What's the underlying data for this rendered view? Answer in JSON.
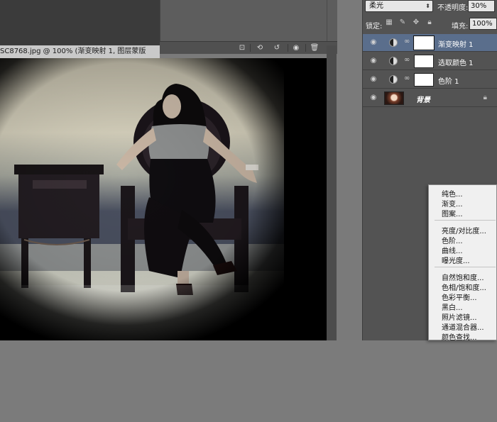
{
  "document": {
    "tab_title": "SC8768.jpg @ 100% (渐变映射 1, 图层蒙版"
  },
  "layers_panel": {
    "blend_mode": "柔光",
    "opacity_label": "不透明度:",
    "opacity_value": "30%",
    "lock_label": "锁定:",
    "fill_label": "填充:",
    "fill_value": "100%",
    "layers": [
      {
        "name": "渐变映射 1",
        "selected": true
      },
      {
        "name": "选取颜色 1",
        "selected": false
      },
      {
        "name": "色阶 1",
        "selected": false
      },
      {
        "name": "背景",
        "selected": false,
        "locked": true
      }
    ]
  },
  "adjustment_menu": {
    "group1": [
      "纯色...",
      "渐变...",
      "图案..."
    ],
    "group2": [
      "亮度/对比度...",
      "色阶...",
      "曲线...",
      "曝光度..."
    ],
    "group3": [
      "自然饱和度...",
      "色相/饱和度...",
      "色彩平衡...",
      "黑白...",
      "照片滤镜...",
      "通道混合器...",
      "颜色查找..."
    ]
  },
  "colors": {
    "selected_layer": "#5a6e8c",
    "panel_bg": "#535353",
    "workspace": "#7b7b7b"
  },
  "icons": {
    "eye": "eye-icon",
    "chain": "chain-link-icon",
    "lock": "lock-icon"
  }
}
